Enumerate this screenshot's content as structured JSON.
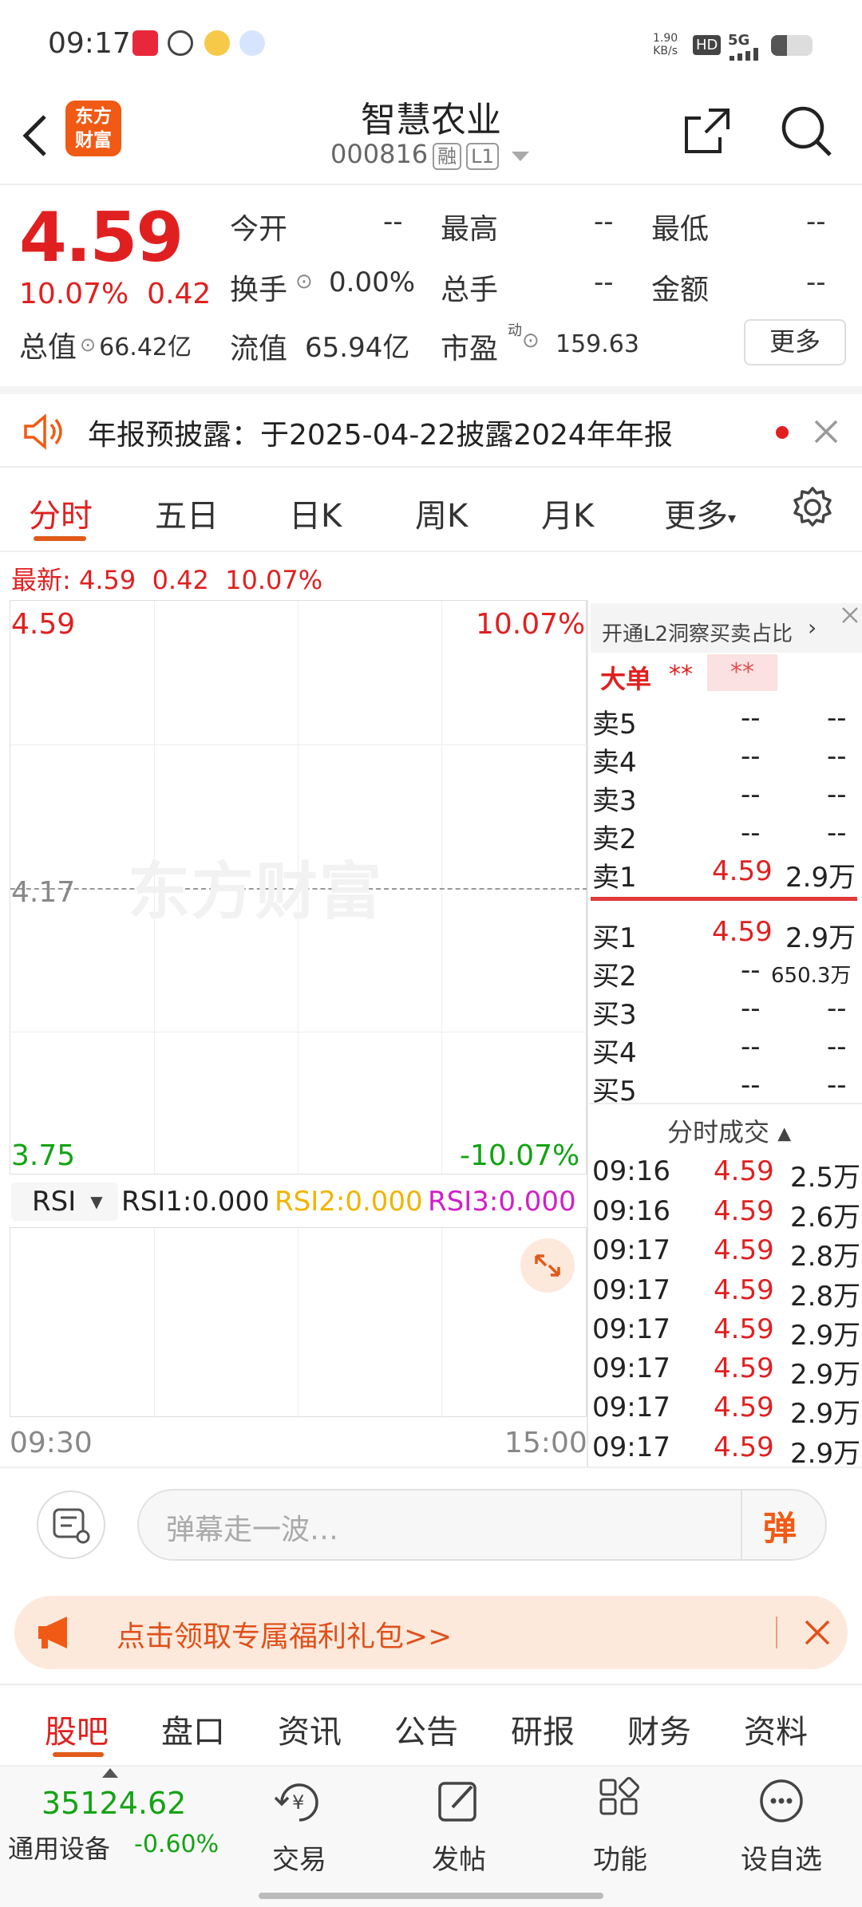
{
  "status": {
    "time": "09:17",
    "net_speed": "1.90",
    "net_unit": "KB/s",
    "hd": "HD",
    "signal": "5G"
  },
  "header": {
    "title": "智慧农业",
    "code": "000816",
    "tag1": "融",
    "tag2": "L1",
    "logo_line1": "东方",
    "logo_line2": "财富"
  },
  "quote": {
    "price": "4.59",
    "pct": "10.07%",
    "change": "0.42",
    "open_label": "今开",
    "open": "--",
    "high_label": "最高",
    "high": "--",
    "low_label": "最低",
    "low": "--",
    "turnover_label": "换手",
    "turnover": "0.00%",
    "volume_label": "总手",
    "volume": "--",
    "amount_label": "金额",
    "amount": "--",
    "mcap_label": "总值",
    "mcap": "66.42亿",
    "float_label": "流值",
    "float": "65.94亿",
    "pe_label": "市盈",
    "pe_sup": "动",
    "pe": "159.63",
    "more": "更多"
  },
  "notice": {
    "text": "年报预披露：于2025-04-22披露2024年年报"
  },
  "tabs": [
    "分时",
    "五日",
    "日K",
    "周K",
    "月K",
    "更多"
  ],
  "latest": {
    "label": "最新:",
    "price": "4.59",
    "change": "0.42",
    "pct": "10.07%"
  },
  "chart": {
    "top_price": "4.59",
    "top_pct": "10.07%",
    "mid_price": "4.17",
    "bottom_price": "3.75",
    "bottom_pct": "-10.07%",
    "watermark": "东方财富",
    "time_start": "09:30",
    "time_end": "15:00",
    "rsi_select": "RSI",
    "rsi1": "RSI1:0.000",
    "rsi2": "RSI2:0.000",
    "rsi3": "RSI3:0.000"
  },
  "orderbook": {
    "l2_text": "开通L2洞察买卖占比",
    "big_label": "大单",
    "big_v1": "**",
    "big_v2": "**",
    "sell": [
      {
        "label": "卖5",
        "price": "--",
        "vol": "--"
      },
      {
        "label": "卖4",
        "price": "--",
        "vol": "--"
      },
      {
        "label": "卖3",
        "price": "--",
        "vol": "--"
      },
      {
        "label": "卖2",
        "price": "--",
        "vol": "--"
      },
      {
        "label": "卖1",
        "price": "4.59",
        "vol": "2.9万"
      }
    ],
    "buy": [
      {
        "label": "买1",
        "price": "4.59",
        "vol": "2.9万"
      },
      {
        "label": "买2",
        "price": "--",
        "vol": "650.3万"
      },
      {
        "label": "买3",
        "price": "--",
        "vol": "--"
      },
      {
        "label": "买4",
        "price": "--",
        "vol": "--"
      },
      {
        "label": "买5",
        "price": "--",
        "vol": "--"
      }
    ],
    "trades_title": "分时成交",
    "trades": [
      {
        "time": "09:16",
        "price": "4.59",
        "vol": "2.5万"
      },
      {
        "time": "09:16",
        "price": "4.59",
        "vol": "2.6万"
      },
      {
        "time": "09:17",
        "price": "4.59",
        "vol": "2.8万"
      },
      {
        "time": "09:17",
        "price": "4.59",
        "vol": "2.8万"
      },
      {
        "time": "09:17",
        "price": "4.59",
        "vol": "2.9万"
      },
      {
        "time": "09:17",
        "price": "4.59",
        "vol": "2.9万"
      },
      {
        "time": "09:17",
        "price": "4.59",
        "vol": "2.9万"
      },
      {
        "time": "09:17",
        "price": "4.59",
        "vol": "2.9万"
      }
    ]
  },
  "comment": {
    "placeholder": "弹幕走一波…",
    "danmu": "弹"
  },
  "promo": {
    "text": "点击领取专属福利礼包>>"
  },
  "bottom_tabs": [
    "股吧",
    "盘口",
    "资讯",
    "公告",
    "研报",
    "财务",
    "资料"
  ],
  "index": {
    "value": "35124.62",
    "name": "通用设备",
    "pct": "-0.60%"
  },
  "nav": [
    "交易",
    "发帖",
    "功能",
    "设自选"
  ],
  "colors": {
    "red": "#e02020",
    "green": "#13a313",
    "orange": "#f05a14"
  }
}
